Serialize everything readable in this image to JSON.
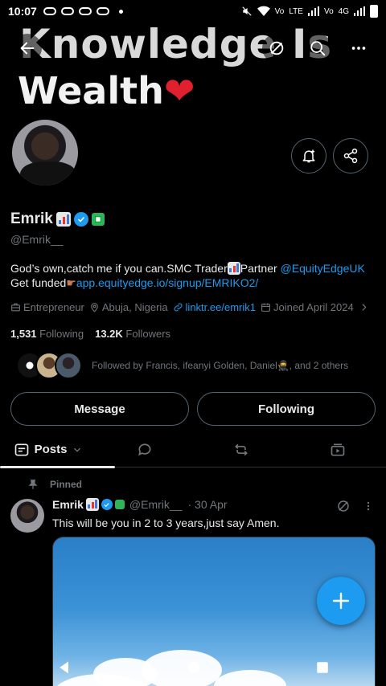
{
  "status": {
    "time": "10:07",
    "labels": [
      "Vo",
      "LTE",
      "Vo",
      "4G"
    ]
  },
  "banner": {
    "line1": "Knowledge Is",
    "line2": "Wealth",
    "heart": "❤"
  },
  "profile": {
    "name": "Emrik",
    "handle": "@Emrik__",
    "bio_text_1": "God’s own,catch me if you can.SMC Trader",
    "bio_text_2": "Partner ",
    "bio_mention": "@EquityEdgeUK",
    "bio_text_3": " Get funded",
    "bio_link": "app.equityedge.io/signup/EMRIKO2/",
    "category": "Entrepreneur",
    "location": "Abuja, Nigeria",
    "website": "linktr.ee/emrik1",
    "joined": "Joined April 2024",
    "following_count": "1,531",
    "following_label": "Following",
    "followers_count": "13.2K",
    "followers_label": "Followers",
    "followed_by": "Followed by Francis, ifeanyi Golden, Daniel🥷, and 2 others"
  },
  "actions": {
    "message": "Message",
    "following": "Following"
  },
  "tabs": {
    "posts": "Posts"
  },
  "post": {
    "pinned": "Pinned",
    "name": "Emrik",
    "handle": "@Emrik__",
    "date": "· 30 Apr",
    "text": "This will be you in 2 to 3 years,just say Amen."
  },
  "colors": {
    "accent": "#1d9bf0",
    "background": "#000000",
    "muted": "#71767b",
    "verified_green": "#2fb45a"
  }
}
